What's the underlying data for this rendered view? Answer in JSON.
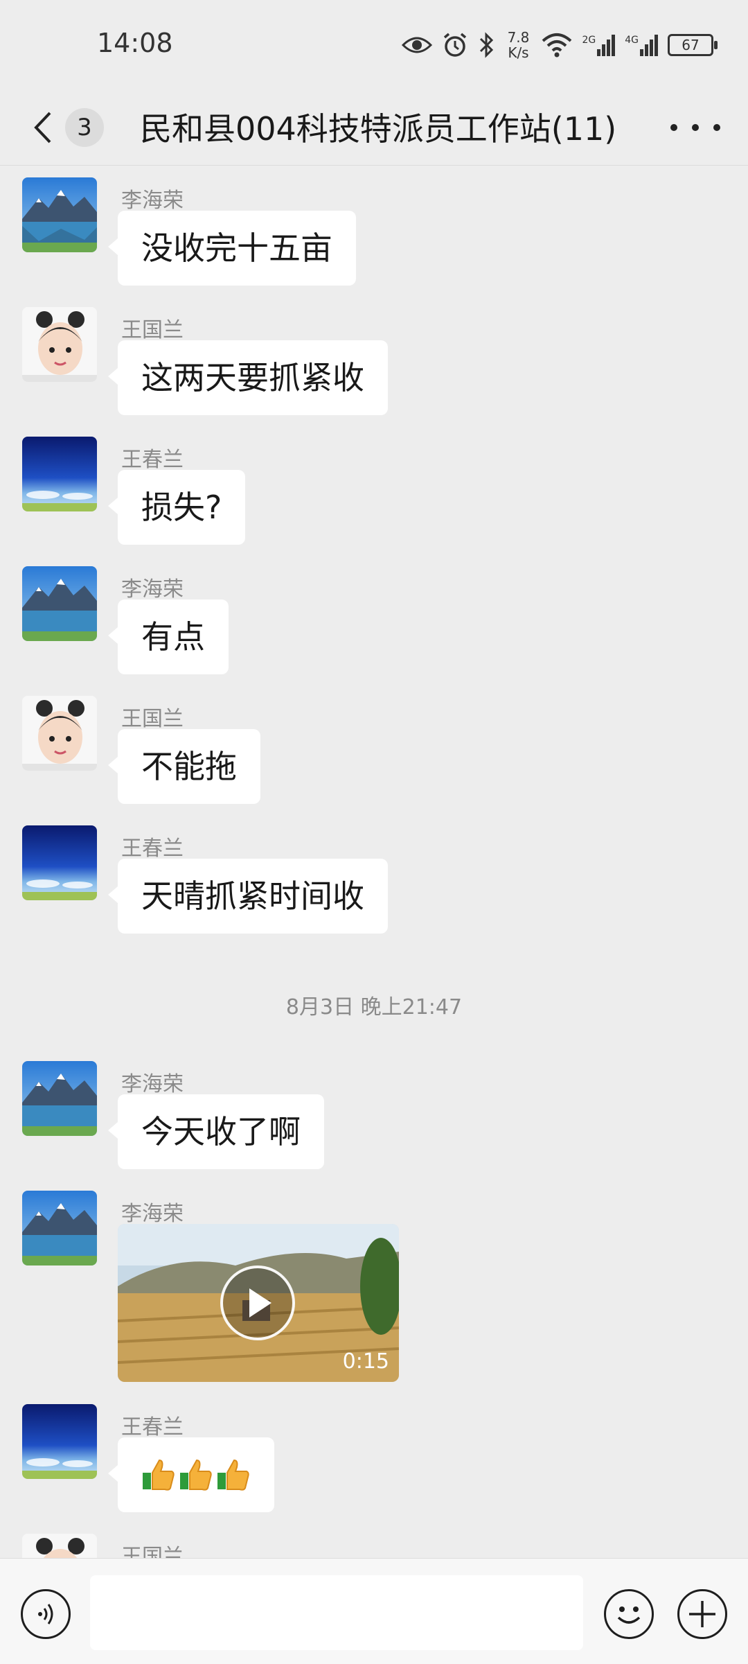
{
  "status_bar": {
    "time": "14:08",
    "net_speed": "7.8",
    "net_unit": "K/s",
    "sig1": "2G",
    "sig2": "4G",
    "battery": "67"
  },
  "header": {
    "unread_count": "3",
    "title": "民和县004科技特派员工作站(11)"
  },
  "messages": [
    {
      "sender": "李海荣",
      "text": "没收完十五亩",
      "avatar": "mountain-lake-avatar"
    },
    {
      "sender": "王国兰",
      "text": "这两天要抓紧收",
      "avatar": "child-photo-avatar"
    },
    {
      "sender": "王春兰",
      "text": "损失?",
      "avatar": "blue-sky-avatar"
    },
    {
      "sender": "李海荣",
      "text": "有点",
      "avatar": "mountain-lake-avatar"
    },
    {
      "sender": "王国兰",
      "text": "不能拖",
      "avatar": "child-photo-avatar"
    },
    {
      "sender": "王春兰",
      "text": "天晴抓紧时间收",
      "avatar": "blue-sky-avatar"
    }
  ],
  "time_separator": "8月3日 晚上21:47",
  "messages_after": [
    {
      "sender": "李海荣",
      "text": "今天收了啊",
      "avatar": "mountain-lake-avatar"
    }
  ],
  "video_message": {
    "sender": "李海荣",
    "duration": "0:15"
  },
  "emoji_message": {
    "sender": "王春兰",
    "emoji": "thumbs-up-icon ×3"
  },
  "partial_message": {
    "sender": "王国兰"
  },
  "input": {
    "placeholder": ""
  }
}
